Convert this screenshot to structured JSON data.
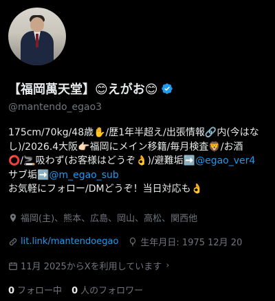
{
  "profile": {
    "display_name": "【福岡萬天堂】😊えがお😊",
    "handle": "@mantendo_egao3",
    "bio_1": "175cm/70kg/48歳✋/歴1年半超え/出張情報🔗内(今はな",
    "bio_2": "し)/2026.4大阪👉🏻福岡にメイン移籍/毎月検査🦁/お酒",
    "bio_3a": "⭕/🚬吸わず(お客様はどうぞ👌)/避難垢➡️",
    "bio_3_link": "@egao_ver4",
    "bio_4a": "サブ垢➡️",
    "bio_4_link": "@m_egao_sub",
    "bio_5": "お気軽にフォロー/DMどうぞ！当日対応も👌",
    "location": "福岡(主)、熊本、広島、岡山、高松、関西他",
    "website": "lit.link/mantendoegao",
    "birthday": "生年月日: 1975 12月 20",
    "joined": "11月 2025からXを利用しています",
    "following_count": "0",
    "following_label": "フォロー中",
    "followers_count": "0",
    "followers_label": "人のフォロワー"
  },
  "colors": {
    "background": "#000000",
    "text": "#e7e9ea",
    "muted": "#71767b",
    "accent": "#1d9bf0"
  },
  "icons": [
    "verified-badge-icon",
    "location-pin-icon",
    "link-icon",
    "balloon-icon",
    "calendar-icon",
    "chevron-right-icon"
  ]
}
